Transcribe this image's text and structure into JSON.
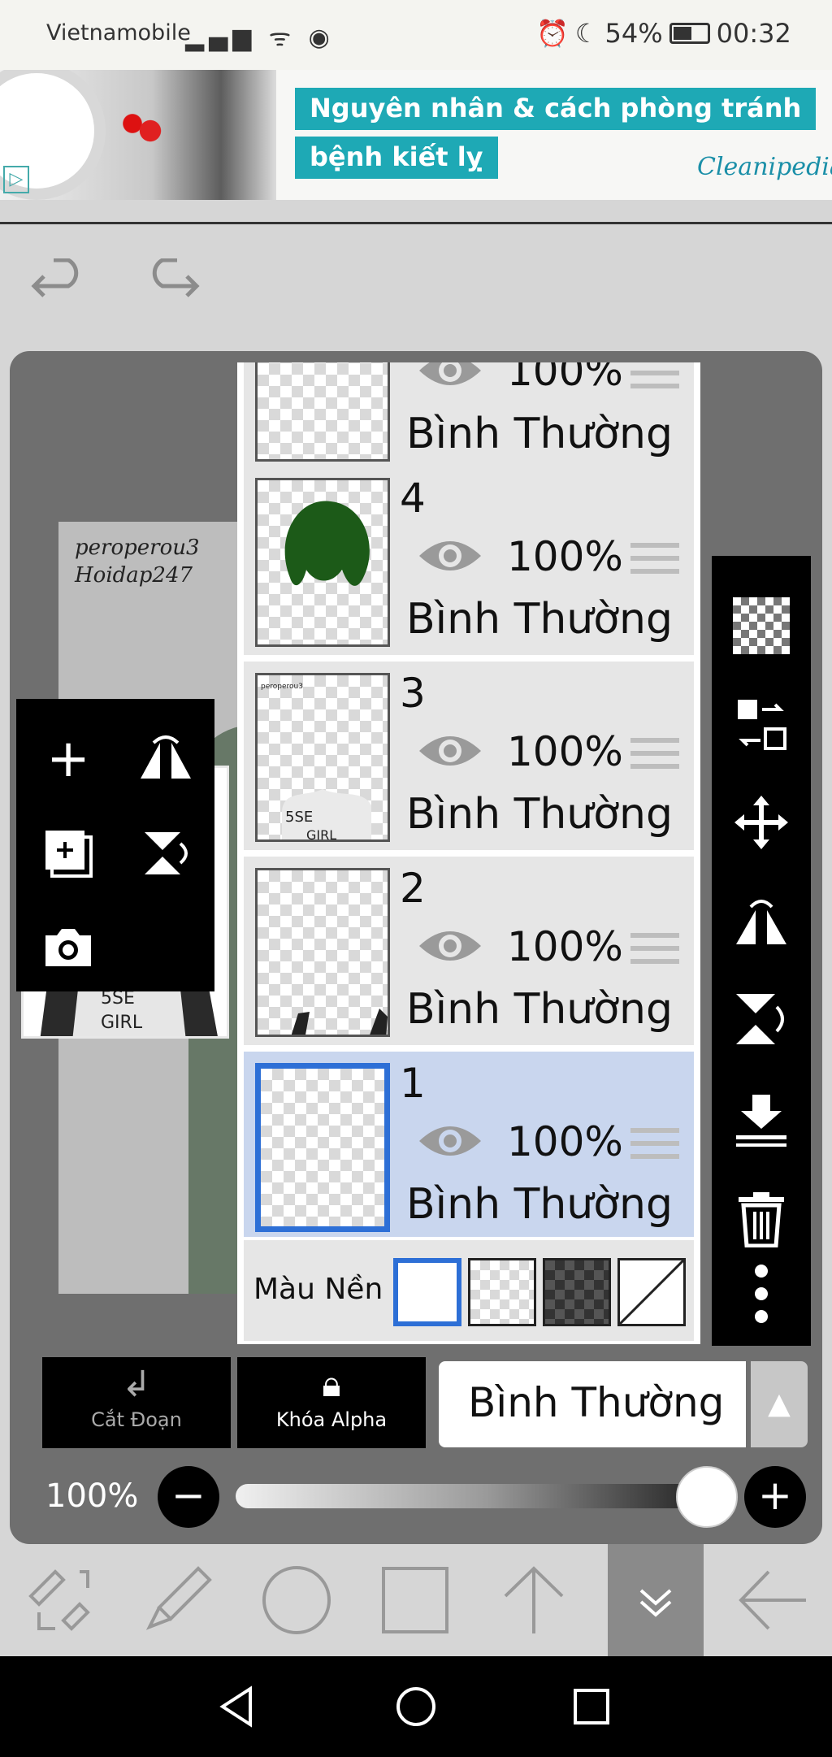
{
  "status_bar": {
    "carrier": "Vietnamobile",
    "battery": "54%",
    "time": "00:32"
  },
  "ad": {
    "line1": "Nguyên nhân & cách phòng tránh",
    "line2": "bệnh kiết lỵ",
    "brand": "Cleanipedia"
  },
  "canvas": {
    "sketch_text": "peroperou3\nHoidap247"
  },
  "layers_panel": {
    "layers": [
      {
        "number": "",
        "opacity": "100%",
        "mode": "Bình Thường",
        "selected": false
      },
      {
        "number": "4",
        "opacity": "100%",
        "mode": "Bình Thường",
        "selected": false
      },
      {
        "number": "3",
        "opacity": "100%",
        "mode": "Bình Thường",
        "selected": false
      },
      {
        "number": "2",
        "opacity": "100%",
        "mode": "Bình Thường",
        "selected": false
      },
      {
        "number": "1",
        "opacity": "100%",
        "mode": "Bình Thường",
        "selected": true
      }
    ],
    "background_label": "Màu Nền"
  },
  "bottom_controls": {
    "clip_label": "Cắt Đoạn",
    "alpha_lock_label": "Khóa Alpha",
    "blend_mode": "Bình Thường",
    "opacity": "100%",
    "opacity_value": 1.0
  },
  "colors": {
    "selected_layer": "#c9d6ee",
    "selection_border": "#2d6fd6",
    "ad_accent": "#1ea9b5"
  }
}
